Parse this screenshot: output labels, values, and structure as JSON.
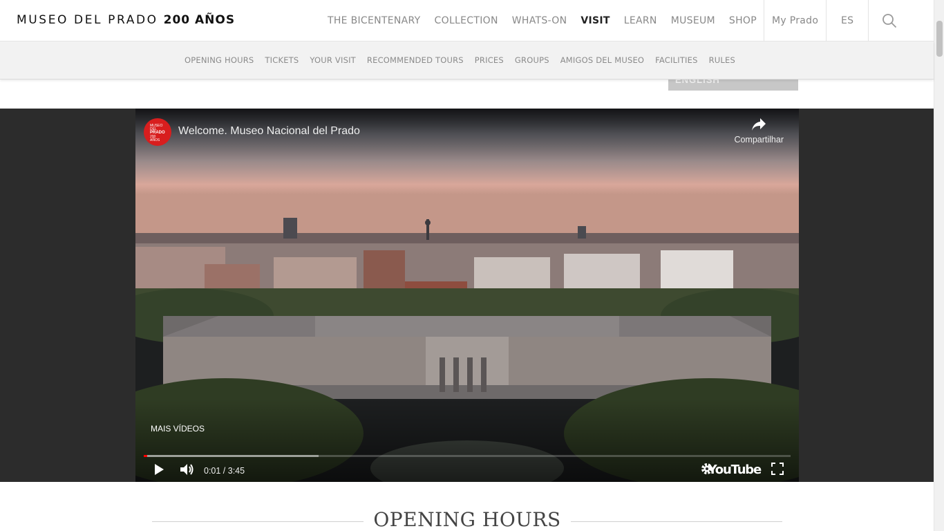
{
  "header": {
    "logo_main": "MUSEO DEL PRADO",
    "logo_bold": "200 AÑOS",
    "nav": [
      {
        "label": "THE BICENTENARY",
        "active": false
      },
      {
        "label": "COLLECTION",
        "active": false
      },
      {
        "label": "WHATS-ON",
        "active": false
      },
      {
        "label": "VISIT",
        "active": true
      },
      {
        "label": "LEARN",
        "active": false
      },
      {
        "label": "MUSEUM",
        "active": false
      },
      {
        "label": "SHOP",
        "active": false
      }
    ],
    "my_prado": "My Prado",
    "language": "ES",
    "search_icon": "search-icon"
  },
  "subnav": [
    "OPENING HOURS",
    "TICKETS",
    "YOUR VISIT",
    "RECOMMENDED TOURS",
    "PRICES",
    "GROUPS",
    "AMIGOS DEL MUSEO",
    "FACILITIES",
    "RULES"
  ],
  "language_dropdown": {
    "visible_option": "ENGLISH"
  },
  "video": {
    "title": "Welcome. Museo Nacional del Prado",
    "channel_logo_lines": [
      "MUSEO",
      "DEL",
      "PRADO",
      "200",
      "AÑOS"
    ],
    "share_label": "Compartilhar",
    "more_videos": "MAIS VÍDEOS",
    "current_time": "0:01",
    "duration": "3:45",
    "time_display": "0:01 / 3:45",
    "played_fraction": 0.005,
    "loaded_fraction": 0.27,
    "youtube_label": "YouTube",
    "icons": [
      "play-icon",
      "volume-icon",
      "settings-icon",
      "fullscreen-icon",
      "share-icon"
    ]
  },
  "section": {
    "title": "OPENING HOURS"
  },
  "colors": {
    "brand_red": "#d81e1e",
    "progress_red": "#ff0000",
    "nav_gray": "#888888",
    "video_band": "#2c2c2c"
  }
}
